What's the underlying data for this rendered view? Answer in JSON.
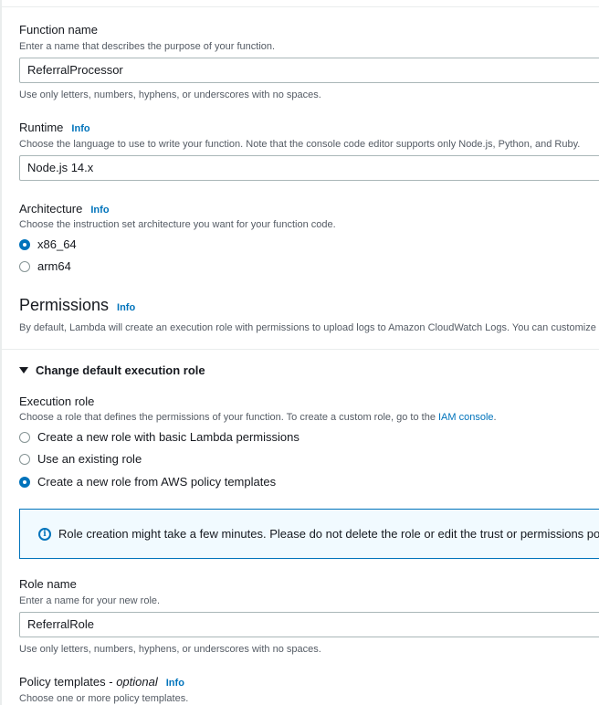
{
  "function_name": {
    "label": "Function name",
    "description": "Enter a name that describes the purpose of your function.",
    "value": "ReferralProcessor",
    "hint": "Use only letters, numbers, hyphens, or underscores with no spaces."
  },
  "runtime": {
    "label": "Runtime",
    "info": "Info",
    "description": "Choose the language to use to write your function. Note that the console code editor supports only Node.js, Python, and Ruby.",
    "value": "Node.js 14.x"
  },
  "architecture": {
    "label": "Architecture",
    "info": "Info",
    "description": "Choose the instruction set architecture you want for your function code.",
    "options": [
      {
        "label": "x86_64",
        "selected": true
      },
      {
        "label": "arm64",
        "selected": false
      }
    ]
  },
  "permissions": {
    "title": "Permissions",
    "info": "Info",
    "description": "By default, Lambda will create an execution role with permissions to upload logs to Amazon CloudWatch Logs. You can customize this default role later when adding triggers."
  },
  "execution_role_section": {
    "toggle_label": "Change default execution role",
    "label": "Execution role",
    "description_prefix": "Choose a role that defines the permissions of your function. To create a custom role, go to the ",
    "description_link": "IAM console",
    "description_suffix": ".",
    "options": [
      {
        "label": "Create a new role with basic Lambda permissions",
        "selected": false
      },
      {
        "label": "Use an existing role",
        "selected": false
      },
      {
        "label": "Create a new role from AWS policy templates",
        "selected": true
      }
    ],
    "alert": "Role creation might take a few minutes. Please do not delete the role or edit the trust or permissions policies in this role."
  },
  "role_name": {
    "label": "Role name",
    "description": "Enter a name for your new role.",
    "value": "ReferralRole",
    "hint": "Use only letters, numbers, hyphens, or underscores with no spaces."
  },
  "policy_templates": {
    "label": "Policy templates - ",
    "optional": "optional",
    "info": "Info",
    "description": "Choose one or more policy templates."
  },
  "colors": {
    "link": "#0073bb",
    "text": "#16191f",
    "secondary_text": "#545b64",
    "alert_bg": "#f1faff"
  }
}
